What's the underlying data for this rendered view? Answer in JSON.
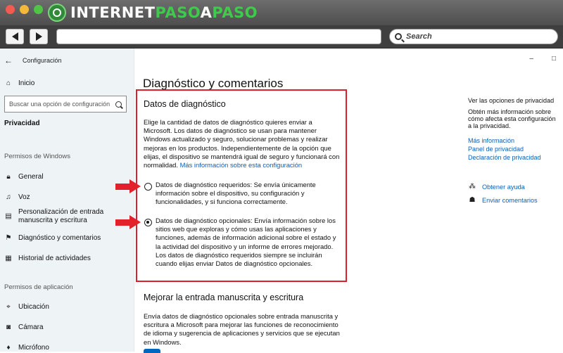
{
  "browser": {
    "logo_part1": "INTERNET",
    "logo_part2": "PASO",
    "logo_part3": "A",
    "logo_part4": "PASO",
    "search_placeholder": "Search",
    "back_icon": "back-arrow-icon",
    "forward_icon": "forward-arrow-icon"
  },
  "window": {
    "title": "Configuración",
    "controls": [
      "–",
      "□"
    ]
  },
  "sidebar": {
    "home": "Inicio",
    "search_placeholder": "Buscar una opción de configuración",
    "current_section": "Privacidad",
    "group1_title": "Permisos de Windows",
    "group1_items": [
      {
        "label": "General",
        "icon": "lock-icon"
      },
      {
        "label": "Voz",
        "icon": "voice-icon"
      },
      {
        "label": "Personalización de entrada manuscrita y escritura",
        "icon": "document-pen-icon"
      },
      {
        "label": "Diagnóstico y comentarios",
        "icon": "feedback-icon"
      },
      {
        "label": "Historial de actividades",
        "icon": "history-icon"
      }
    ],
    "group2_title": "Permisos de aplicación",
    "group2_items": [
      {
        "label": "Ubicación",
        "icon": "location-icon"
      },
      {
        "label": "Cámara",
        "icon": "camera-icon"
      },
      {
        "label": "Micrófono",
        "icon": "microphone-icon"
      }
    ]
  },
  "main": {
    "title": "Diagnóstico y comentarios",
    "diag_heading": "Datos de diagnóstico",
    "diag_intro": "Elige la cantidad de datos de diagnóstico quieres enviar a Microsoft. Los datos de diagnóstico se usan para mantener Windows actualizado y seguro, solucionar problemas y realizar mejoras en los productos. Independientemente de la opción que elijas, el dispositivo se mantendrá igual de seguro y funcionará con normalidad.",
    "diag_link": "Más información sobre esta configuración",
    "option_required": {
      "label": "Datos de diagnóstico requeridos: Se envía únicamente información sobre el dispositivo, su configuración y funcionalidades, y si funciona correctamente.",
      "selected": false
    },
    "option_optional": {
      "label": "Datos de diagnóstico opcionales: Envía información sobre los sitios web que exploras y cómo usas las aplicaciones y funciones, además de información adicional sobre el estado y la actividad del dispositivo y un informe de errores mejorado. Los datos de diagnóstico requeridos siempre se incluirán cuando elijas enviar Datos de diagnóstico opcionales.",
      "selected": true
    },
    "ink_heading": "Mejorar la entrada manuscrita y escritura",
    "ink_text": "Envía datos de diagnóstico opcionales sobre entrada manuscrita y escritura a Microsoft para mejorar las funciones de reconocimiento de idioma y sugerencia de aplicaciones y servicios que se ejecutan en Windows."
  },
  "right_panel": {
    "heading": "Ver las opciones de privacidad",
    "description": "Obtén más información sobre cómo afecta esta configuración a la privacidad.",
    "links": [
      "Más información",
      "Panel de privacidad",
      "Declaración de privacidad"
    ],
    "help": "Obtener ayuda",
    "feedback": "Enviar comentarios"
  },
  "colors": {
    "highlight_red": "#d9202d",
    "link_blue": "#0b5fb7",
    "sidebar_bg": "#eef3f6"
  }
}
